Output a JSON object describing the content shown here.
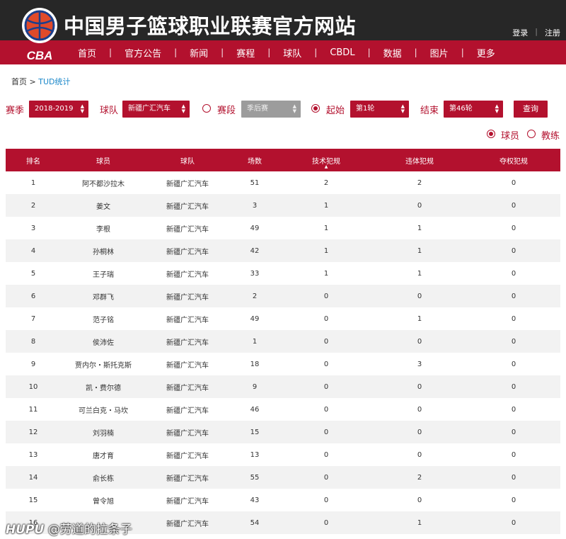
{
  "header": {
    "site_title": "中国男子篮球职业联赛官方网站",
    "logo_text": "CBA",
    "login": "登录",
    "register": "注册",
    "auth_separator": "|"
  },
  "nav": {
    "items": [
      "首页",
      "官方公告",
      "新闻",
      "赛程",
      "球队",
      "CBDL",
      "数据",
      "图片",
      "更多"
    ],
    "separator": "|"
  },
  "breadcrumb": {
    "home": "首页",
    "separator": " > ",
    "current": "TUD统计"
  },
  "filters": {
    "season_label": "赛季",
    "season_value": "2018-2019",
    "team_label": "球队",
    "team_value": "新疆广汇汽车",
    "stage_label": "赛段",
    "stage_value": "季后赛",
    "start_label": "起始",
    "start_value": "第1轮",
    "end_label": "结束",
    "end_value": "第46轮",
    "query_button": "查询",
    "stage_radio_selected": false,
    "start_radio_selected": true
  },
  "type_toggle": {
    "player_label": "球员",
    "coach_label": "教练",
    "selected": "player"
  },
  "table": {
    "headers": [
      "排名",
      "球员",
      "球队",
      "场数",
      "技术犯规",
      "违体犯规",
      "夺权犯规"
    ],
    "sort_indicator": "▲",
    "rows": [
      [
        "1",
        "阿不都沙拉木",
        "新疆广汇汽车",
        "51",
        "2",
        "2",
        "0"
      ],
      [
        "2",
        "姜文",
        "新疆广汇汽车",
        "3",
        "1",
        "0",
        "0"
      ],
      [
        "3",
        "李根",
        "新疆广汇汽车",
        "49",
        "1",
        "1",
        "0"
      ],
      [
        "4",
        "孙桐林",
        "新疆广汇汽车",
        "42",
        "1",
        "1",
        "0"
      ],
      [
        "5",
        "王子瑞",
        "新疆广汇汽车",
        "33",
        "1",
        "1",
        "0"
      ],
      [
        "6",
        "邓群飞",
        "新疆广汇汽车",
        "2",
        "0",
        "0",
        "0"
      ],
      [
        "7",
        "范子铭",
        "新疆广汇汽车",
        "49",
        "0",
        "1",
        "0"
      ],
      [
        "8",
        "侯沛佐",
        "新疆广汇汽车",
        "1",
        "0",
        "0",
        "0"
      ],
      [
        "9",
        "贾内尔・斯托克斯",
        "新疆广汇汽车",
        "18",
        "0",
        "3",
        "0"
      ],
      [
        "10",
        "凯・费尔德",
        "新疆广汇汽车",
        "9",
        "0",
        "0",
        "0"
      ],
      [
        "11",
        "可兰白克・马坎",
        "新疆广汇汽车",
        "46",
        "0",
        "0",
        "0"
      ],
      [
        "12",
        "刘羽楠",
        "新疆广汇汽车",
        "15",
        "0",
        "0",
        "0"
      ],
      [
        "13",
        "唐才育",
        "新疆广汇汽车",
        "13",
        "0",
        "0",
        "0"
      ],
      [
        "14",
        "俞长栋",
        "新疆广汇汽车",
        "55",
        "0",
        "2",
        "0"
      ],
      [
        "15",
        "曾令旭",
        "新疆广汇汽车",
        "43",
        "0",
        "0",
        "0"
      ],
      [
        "16",
        "",
        "新疆广汇汽车",
        "54",
        "0",
        "1",
        "0"
      ]
    ]
  },
  "watermark": {
    "brand": "HUPU",
    "user": "@劳道的拉条子"
  },
  "colors": {
    "brand_red": "#b3112e",
    "header_dark": "#272727",
    "link_blue": "#1a87c9",
    "row_alt": "#f2f2f2"
  }
}
